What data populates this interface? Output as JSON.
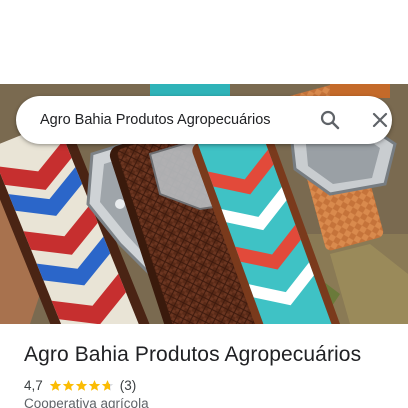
{
  "search": {
    "query": "Agro Bahia Produtos Agropecuários",
    "search_icon": "search-icon",
    "close_icon": "close-icon"
  },
  "photo": {
    "description_icon": "place-photo"
  },
  "place": {
    "title": "Agro Bahia Produtos Agropecuários",
    "rating": "4,7",
    "rating_fraction": 0.94,
    "reviews": "(3)",
    "category": "Cooperativa agrícola"
  },
  "colors": {
    "star": "#fbbc04",
    "text_primary": "#202124",
    "text_secondary": "#5f6368",
    "icon": "#5f6368"
  }
}
